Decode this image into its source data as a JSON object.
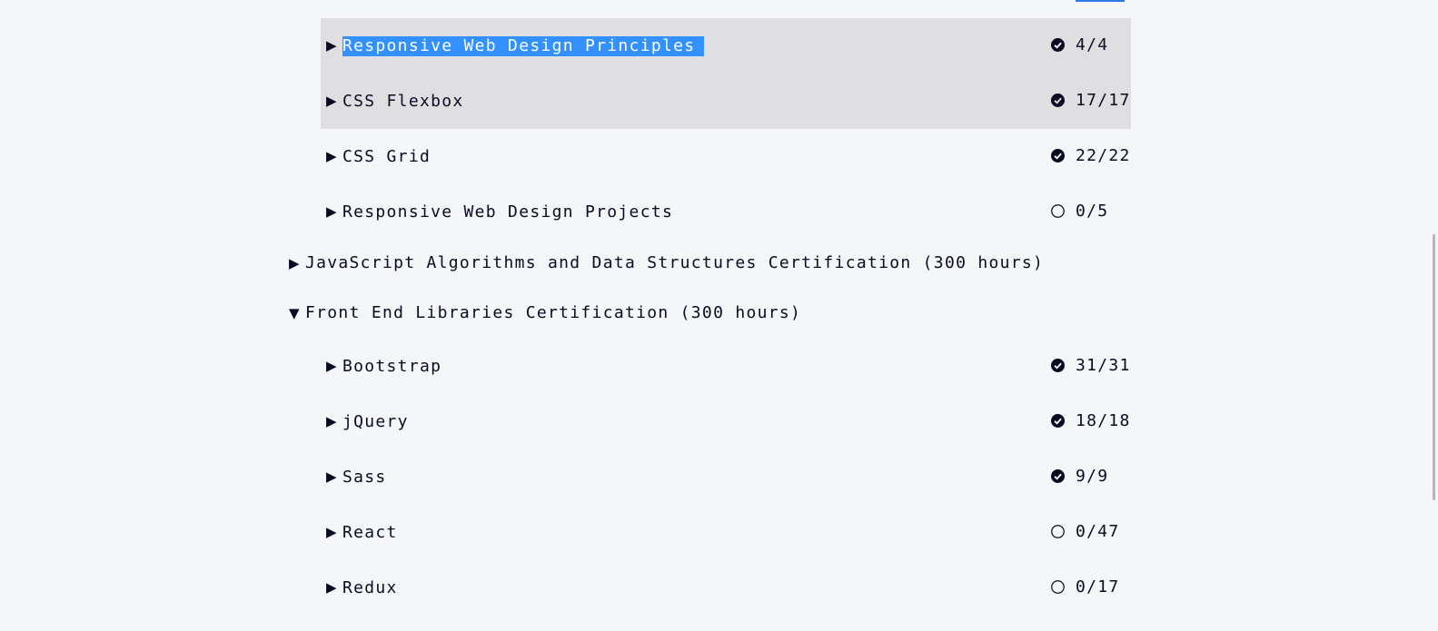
{
  "curriculum": {
    "rwd_blocks": [
      {
        "title": "Responsive Web Design Principles",
        "progress": "4/4",
        "status": "complete",
        "selected": true
      },
      {
        "title": "CSS Flexbox",
        "progress": "17/17",
        "status": "complete",
        "hovered": true
      },
      {
        "title": "CSS Grid",
        "progress": "22/22",
        "status": "complete"
      },
      {
        "title": "Responsive Web Design Projects",
        "progress": "0/5",
        "status": "incomplete"
      }
    ],
    "superblocks": [
      {
        "title": "JavaScript Algorithms and Data Structures Certification (300 hours)",
        "arrow": "▶",
        "expanded": false
      },
      {
        "title": "Front End Libraries Certification (300 hours)",
        "arrow": "▼",
        "expanded": true
      }
    ],
    "fel_blocks": [
      {
        "title": "Bootstrap",
        "progress": "31/31",
        "status": "complete"
      },
      {
        "title": "jQuery",
        "progress": "18/18",
        "status": "complete"
      },
      {
        "title": "Sass",
        "progress": "9/9",
        "status": "complete"
      },
      {
        "title": "React",
        "progress": "0/47",
        "status": "incomplete"
      },
      {
        "title": "Redux",
        "progress": "0/17",
        "status": "incomplete"
      }
    ],
    "collapsed_arrow": "▶",
    "icons": {
      "complete": "check-circle-icon",
      "incomplete": "empty-circle-icon"
    }
  },
  "colors": {
    "background": "#f5f6f7",
    "text": "#0a0a23",
    "selection": "#3390ff",
    "hover": "#dfdfe2"
  }
}
